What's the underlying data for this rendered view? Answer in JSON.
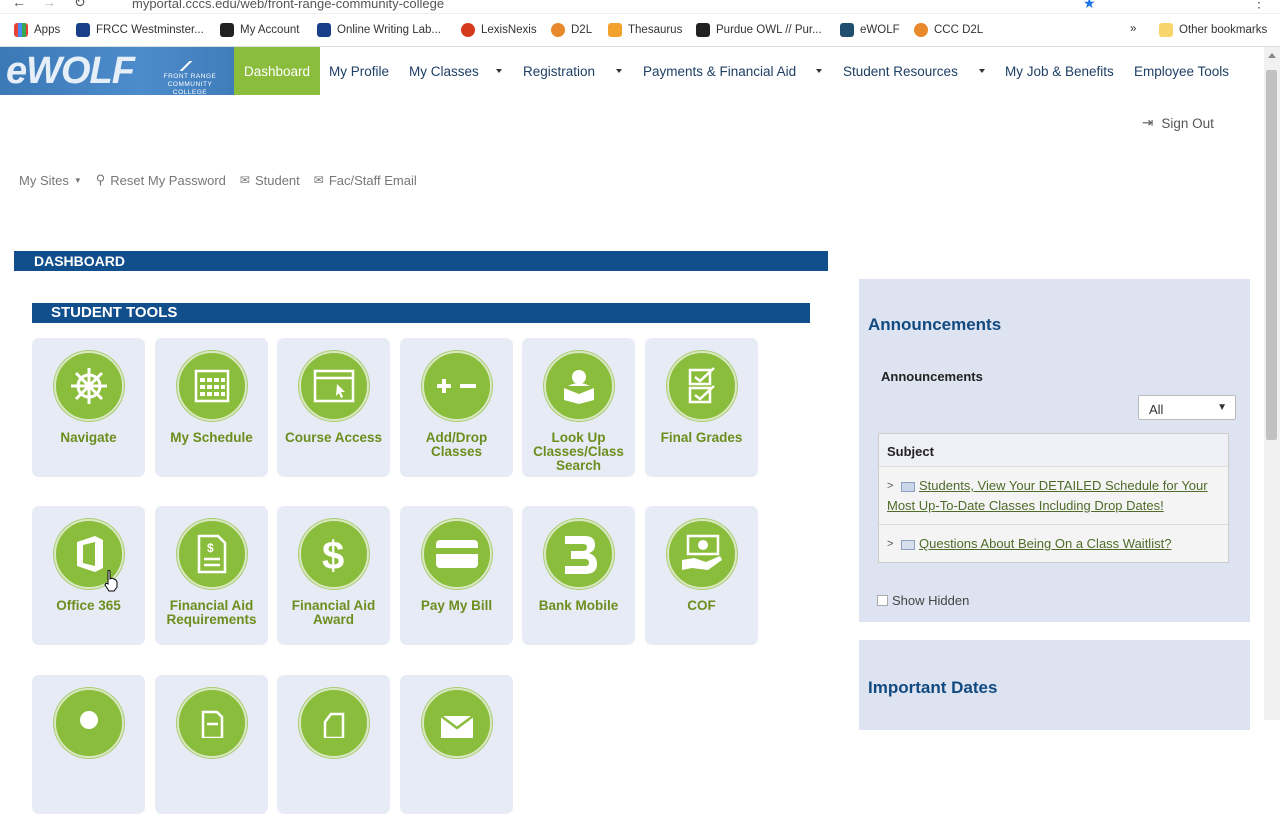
{
  "browser": {
    "url": "myportal.cccs.edu/web/front-range-community-college"
  },
  "bookmarks": [
    {
      "label": "Apps",
      "color": "#4a8af4"
    },
    {
      "label": "FRCC Westminster...",
      "color": "#1a3f8a"
    },
    {
      "label": "My Account",
      "color": "#222222"
    },
    {
      "label": "Online Writing Lab...",
      "color": "#1a3f8a"
    },
    {
      "label": "LexisNexis",
      "color": "#d63a1d"
    },
    {
      "label": "D2L",
      "color": "#e8892b"
    },
    {
      "label": "Thesaurus",
      "color": "#f2a12d"
    },
    {
      "label": "Purdue OWL // Pur...",
      "color": "#222222"
    },
    {
      "label": "eWOLF",
      "color": "#1f4e6e"
    },
    {
      "label": "CCC D2L",
      "color": "#e8892b"
    }
  ],
  "bookmarks_more": "»",
  "bookmarks_other": "Other bookmarks",
  "logo": {
    "text": "eWOLF",
    "subtitle": "FRONT RANGE COMMUNITY COLLEGE"
  },
  "nav": {
    "dashboard": "Dashboard",
    "my_profile": "My Profile",
    "my_classes": "My Classes",
    "registration": "Registration",
    "payments": "Payments & Financial Aid",
    "student_resources": "Student Resources",
    "job_benefits": "My Job & Benefits",
    "employee_tools": "Employee Tools"
  },
  "sign_out": "Sign Out",
  "utility": {
    "my_sites": "My Sites",
    "reset_password": "Reset My Password",
    "student": "Student",
    "fac_staff_email": "Fac/Staff Email"
  },
  "dashboard_title": "DASHBOARD",
  "student_tools_title": "STUDENT TOOLS",
  "tools": {
    "t1": "Navigate",
    "t2": "My Schedule",
    "t3": "Course Access",
    "t4": "Add/Drop Classes",
    "t5": "Look Up Classes/Class Search",
    "t6": "Final Grades",
    "t7": "Office 365",
    "t8": "Financial Aid Requirements",
    "t9": "Financial Aid Award",
    "t10": "Pay My Bill",
    "t11": "Bank Mobile",
    "t12": "COF"
  },
  "announcements": {
    "title": "Announcements",
    "subtitle": "Announcements",
    "filter_value": "All",
    "column_subject": "Subject",
    "items": [
      "Students, View Your DETAILED Schedule for Your Most Up-To-Date Classes Including Drop Dates!",
      "Questions About Being On a Class Waitlist?"
    ],
    "show_hidden": "Show Hidden"
  },
  "important_dates": {
    "title": "Important Dates"
  },
  "colors": {
    "nav_active": "#8bbd3c",
    "bar_blue": "#104e8c",
    "tile_bg": "#e6ebf5",
    "heading_blue": "#124a80"
  }
}
